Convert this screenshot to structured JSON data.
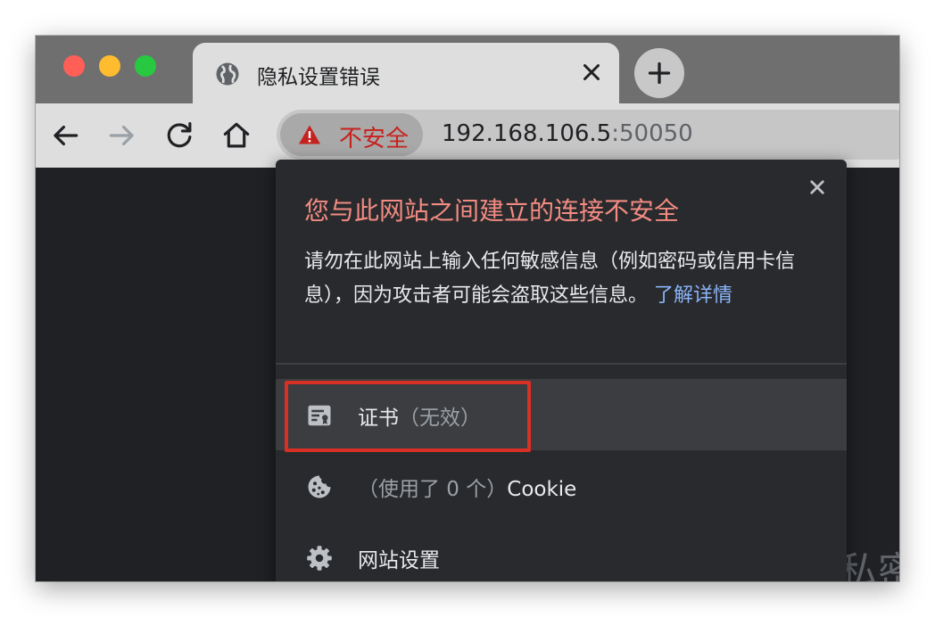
{
  "tab": {
    "title": "隐私设置错误",
    "icon": "globe-icon"
  },
  "toolbar": {
    "security_chip": "不安全",
    "url_host": "192.168.106.5",
    "url_port": ":50050"
  },
  "background": {
    "partial_text": "私密"
  },
  "popup": {
    "title": "您与此网站之间建立的连接不安全",
    "description": "请勿在此网站上输入任何敏感信息（例如密码或信用卡信息），因为攻击者可能会盗取这些信息。",
    "learn_more": "了解详情",
    "certificate": {
      "label": "证书",
      "status": "（无效）",
      "icon": "certificate-icon"
    },
    "cookies": {
      "prefix": "（使用了 0 个）",
      "label": "Cookie",
      "icon": "cookie-icon"
    },
    "site_settings": {
      "label": "网站设置",
      "icon": "gear-icon"
    }
  },
  "colors": {
    "warning_red": "#c5221f",
    "popup_title": "#f28b82",
    "link_blue": "#8ab4f8",
    "popup_bg": "#292a2d",
    "highlight_box": "#d93025"
  }
}
